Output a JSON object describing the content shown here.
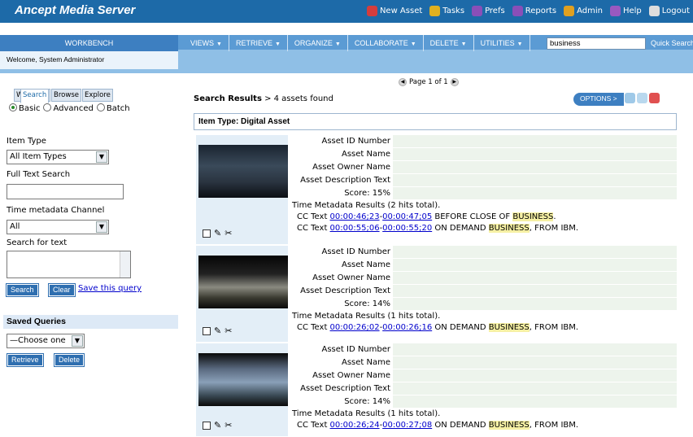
{
  "app": {
    "title": "Ancept Media Server"
  },
  "topnav": [
    {
      "label": "New Asset",
      "icon": "new-asset-icon",
      "color": "#d43d3d"
    },
    {
      "label": "Tasks",
      "icon": "tasks-icon",
      "color": "#e0b020"
    },
    {
      "label": "Prefs",
      "icon": "prefs-icon",
      "color": "#8a4fb8"
    },
    {
      "label": "Reports",
      "icon": "reports-icon",
      "color": "#8a4fb8"
    },
    {
      "label": "Admin",
      "icon": "admin-icon",
      "color": "#e0a020"
    },
    {
      "label": "Help",
      "icon": "help-icon",
      "color": "#9a59c0"
    },
    {
      "label": "Logout",
      "icon": "logout-icon",
      "color": "#dddddd"
    }
  ],
  "workbench": "WORKBENCH",
  "welcome": "Welcome, System Administrator",
  "menu": [
    "VIEWS",
    "RETRIEVE",
    "ORGANIZE",
    "COLLABORATE",
    "DELETE",
    "UTILITIES"
  ],
  "search": {
    "value": "business",
    "quick_label": "Quick Search"
  },
  "lefttabs": [
    "Search",
    "Workflow",
    "Browse",
    "Explore"
  ],
  "modes": [
    "Basic",
    "Advanced",
    "Batch"
  ],
  "item_type": {
    "label": "Item Type",
    "value": "All Item Types"
  },
  "full_text": {
    "label": "Full Text Search",
    "value": ""
  },
  "time_channel": {
    "label": "Time metadata Channel",
    "value": "All"
  },
  "search_text": {
    "label": "Search for text"
  },
  "buttons": {
    "search": "Search",
    "clear": "Clear",
    "save": "Save this query",
    "retrieve": "Retrieve",
    "delete": "Delete"
  },
  "saved": {
    "title": "Saved Queries",
    "value": "—Choose one"
  },
  "pager": {
    "text": "Page 1 of 1"
  },
  "results": {
    "label": "Search Results",
    "text": " > 4 assets found"
  },
  "options": "OPTIONS >",
  "item_type_header": "Item Type: Digital Asset",
  "fields": [
    "Asset ID Number",
    "Asset Name",
    "Asset Owner Name",
    "Asset Description Text"
  ],
  "assets": [
    {
      "score": "Score: 15%",
      "tm": "Time Metadata Results (2 hits total).",
      "cc": [
        {
          "a": "00:00:46;23",
          "b": "00:00:47;05",
          "pre": " BEFORE CLOSE OF ",
          "hit": "BUSINESS",
          "post": "."
        },
        {
          "a": "00:00:55;06",
          "b": "00:00:55;20",
          "pre": " ON DEMAND ",
          "hit": "BUSINESS",
          "post": ", FROM IBM."
        }
      ]
    },
    {
      "score": "Score: 14%",
      "tm": "Time Metadata Results (1 hits total).",
      "cc": [
        {
          "a": "00:00:26;02",
          "b": "00:00:26;16",
          "pre": " ON DEMAND ",
          "hit": "BUSINESS",
          "post": ", FROM IBM."
        }
      ]
    },
    {
      "score": "Score: 14%",
      "tm": "Time Metadata Results (1 hits total).",
      "cc": [
        {
          "a": "00:00:26;24",
          "b": "00:00:27;08",
          "pre": " ON DEMAND ",
          "hit": "BUSINESS",
          "post": ", FROM IBM."
        }
      ]
    }
  ]
}
